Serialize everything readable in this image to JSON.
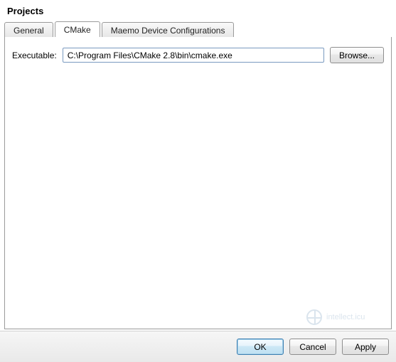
{
  "title": "Projects",
  "tabs": [
    {
      "label": "General",
      "active": false
    },
    {
      "label": "CMake",
      "active": true
    },
    {
      "label": "Maemo Device Configurations",
      "active": false
    }
  ],
  "form": {
    "executable_label": "Executable:",
    "executable_value": "C:\\Program Files\\CMake 2.8\\bin\\cmake.exe",
    "browse_label": "Browse..."
  },
  "buttons": {
    "ok": "OK",
    "cancel": "Cancel",
    "apply": "Apply"
  },
  "watermark": "intellect.icu"
}
